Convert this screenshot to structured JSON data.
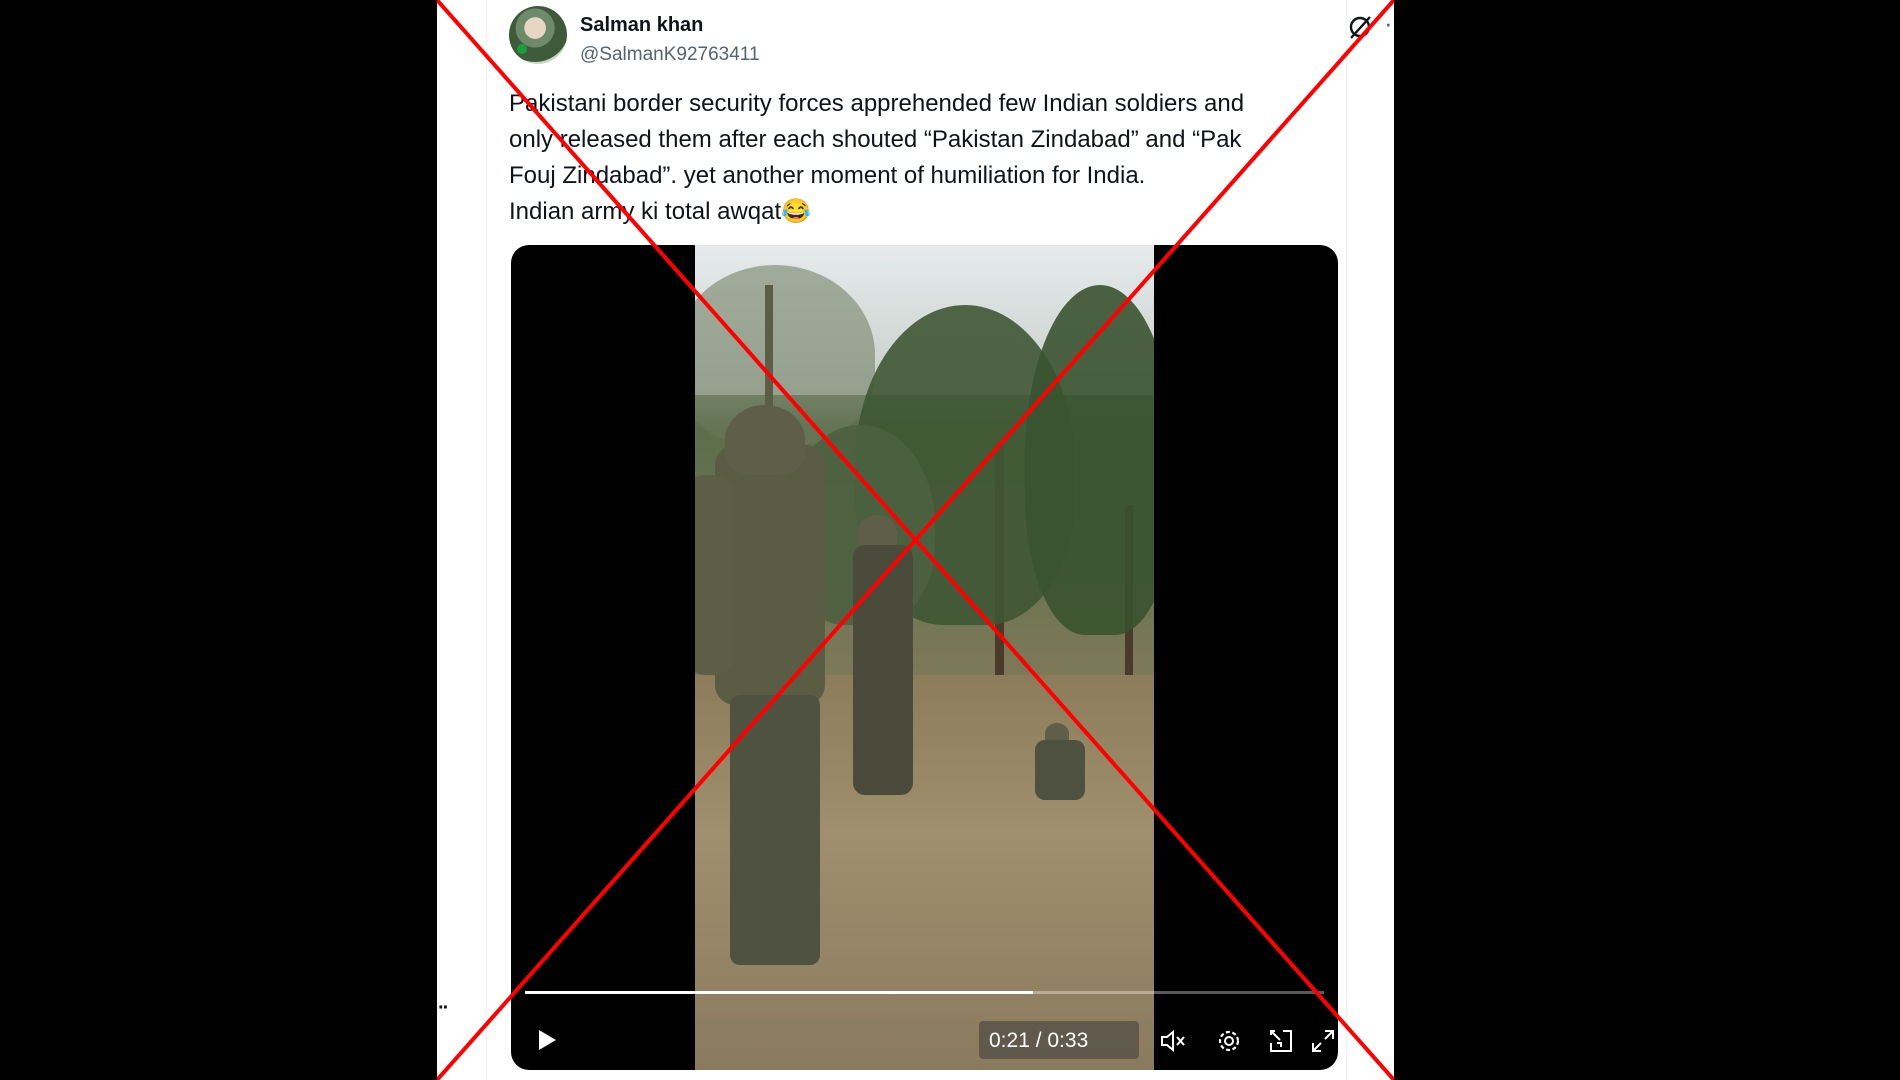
{
  "tweet": {
    "user_name": "Salman khan",
    "handle": "@SalmanK92763411",
    "text_lines": [
      "Pakistani border security forces apprehended few Indian soldiers and",
      "only released them after each shouted “Pakistan Zindabad” and “Pak",
      "Fouj Zindabad”. yet another moment of humiliation for India.",
      "Indian army ki total awqat😂"
    ]
  },
  "header_icons": {
    "grok": "grok-icon",
    "more": "···"
  },
  "side_dots": "··",
  "video": {
    "current_time": "0:21",
    "separator": "/",
    "duration": "0:33",
    "time_display": "0:21 / 0:33",
    "progress": 0.636,
    "controls": [
      "play-icon",
      "mute-icon",
      "settings-icon",
      "exit-dock-icon",
      "fullscreen-icon"
    ]
  },
  "overlay": {
    "cross_color": "#ff0000"
  }
}
